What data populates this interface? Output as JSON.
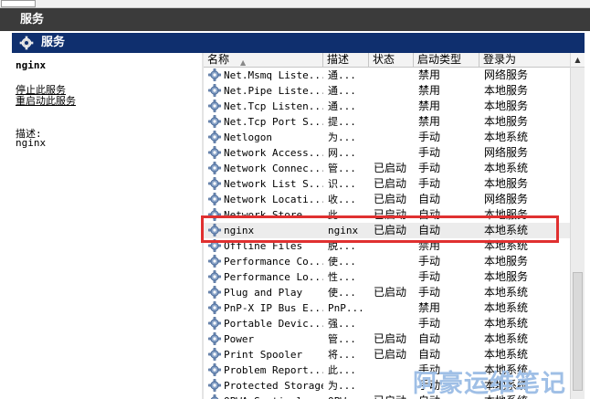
{
  "window": {
    "title": "服务"
  },
  "panel": {
    "title": "服务"
  },
  "left": {
    "service_name": "nginx",
    "stop_link": "停止",
    "stop_rest": "此服务",
    "restart_link": "重启动",
    "restart_rest": "此服务",
    "desc_label": "描述:",
    "desc_value": "nginx"
  },
  "columns": [
    "名称",
    "描述",
    "状态",
    "启动类型",
    "登录为"
  ],
  "rows": [
    {
      "name": "Net.Msmq Liste...",
      "desc": "通...",
      "state": "",
      "start": "禁用",
      "logon": "网络服务"
    },
    {
      "name": "Net.Pipe Liste...",
      "desc": "通...",
      "state": "",
      "start": "禁用",
      "logon": "本地服务"
    },
    {
      "name": "Net.Tcp Listen...",
      "desc": "通...",
      "state": "",
      "start": "禁用",
      "logon": "本地服务"
    },
    {
      "name": "Net.Tcp Port S...",
      "desc": "提...",
      "state": "",
      "start": "禁用",
      "logon": "本地服务"
    },
    {
      "name": "Netlogon",
      "desc": "为...",
      "state": "",
      "start": "手动",
      "logon": "本地系统"
    },
    {
      "name": "Network Access...",
      "desc": "网...",
      "state": "",
      "start": "手动",
      "logon": "网络服务"
    },
    {
      "name": "Network Connec...",
      "desc": "管...",
      "state": "已启动",
      "start": "手动",
      "logon": "本地系统"
    },
    {
      "name": "Network List S...",
      "desc": "识...",
      "state": "已启动",
      "start": "手动",
      "logon": "本地服务"
    },
    {
      "name": "Network Locati...",
      "desc": "收...",
      "state": "已启动",
      "start": "自动",
      "logon": "网络服务"
    },
    {
      "name": "Network Store ...",
      "desc": "此...",
      "state": "已启动",
      "start": "自动",
      "logon": "本地服务"
    },
    {
      "name": "nginx",
      "desc": "nginx",
      "state": "已启动",
      "start": "自动",
      "logon": "本地系统"
    },
    {
      "name": "Offline Files",
      "desc": "脱...",
      "state": "",
      "start": "禁用",
      "logon": "本地系统"
    },
    {
      "name": "Performance Co...",
      "desc": "使...",
      "state": "",
      "start": "手动",
      "logon": "本地服务"
    },
    {
      "name": "Performance Lo...",
      "desc": "性...",
      "state": "",
      "start": "手动",
      "logon": "本地服务"
    },
    {
      "name": "Plug and Play",
      "desc": "使...",
      "state": "已启动",
      "start": "手动",
      "logon": "本地系统"
    },
    {
      "name": "PnP-X IP Bus E...",
      "desc": "PnP...",
      "state": "",
      "start": "禁用",
      "logon": "本地系统"
    },
    {
      "name": "Portable Devic...",
      "desc": "强...",
      "state": "",
      "start": "手动",
      "logon": "本地系统"
    },
    {
      "name": "Power",
      "desc": "管...",
      "state": "已启动",
      "start": "自动",
      "logon": "本地系统"
    },
    {
      "name": "Print Spooler",
      "desc": "将...",
      "state": "已启动",
      "start": "自动",
      "logon": "本地系统"
    },
    {
      "name": "Problem Report...",
      "desc": "此...",
      "state": "",
      "start": "手动",
      "logon": "本地系统"
    },
    {
      "name": "Protected Storage",
      "desc": "为...",
      "state": "",
      "start": "手动",
      "logon": "本地系统"
    },
    {
      "name": "QPWA Sentinal",
      "desc": "QPW...",
      "state": "已启动",
      "start": "自动",
      "logon": "本地系统"
    }
  ],
  "selected_row": 10,
  "watermark": "阿豪运维笔记",
  "colors": {
    "panel_header": "#0f2f6e",
    "highlight": "#e03030",
    "watermark": "#9fbfe6"
  }
}
